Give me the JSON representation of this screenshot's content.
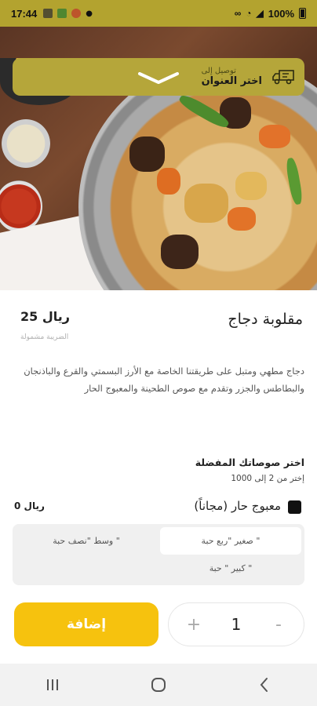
{
  "status_bar": {
    "time": "17:44",
    "battery": "100%",
    "icons": [
      "nfc-icon",
      "android-icon",
      "chrome-icon",
      "dot-icon",
      "link-icon",
      "wifi-icon",
      "signal-icon",
      "battery-icon"
    ]
  },
  "delivery": {
    "deliver_to": "توصيل إلى",
    "choose_address": "اختر العنوان"
  },
  "product": {
    "title": "مقلوبة دجاج",
    "price": "25 ريال",
    "tax_note": "الضريبة مشمولة",
    "description": "دجاج مطهي ومتبل على طريقتنا الخاصة مع الأرز البسمتي والقرع والباذنجان والبطاطس والجزر وتقدم مع صوص الطحينة والمعبوج الحار"
  },
  "sauces": {
    "title": "اختر صوصاتك المفضلة",
    "subtitle": "إختر من 2 إلى 1000",
    "option": {
      "label": "معبوج حار (مجاناً)",
      "price": "0 ريال",
      "checked": true
    },
    "sizes": {
      "small": "صغير \"ربع حبة \"",
      "medium": "وسط \"نصف حبة \"",
      "large": "كبير \" حبة \""
    }
  },
  "quantity": {
    "value": "1",
    "plus": "+",
    "minus": "-"
  },
  "add_button": "إضافة",
  "colors": {
    "accent": "#f6c20e",
    "header": "#b5a63a"
  },
  "image_carousel": {
    "slides": 2,
    "active": 2
  }
}
